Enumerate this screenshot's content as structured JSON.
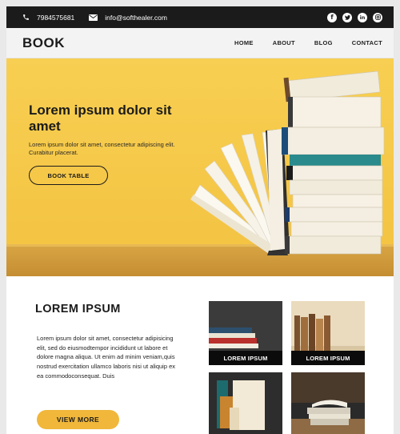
{
  "topbar": {
    "phone": "7984575681",
    "email": "info@softhealer.com",
    "social": [
      "facebook-icon",
      "twitter-icon",
      "linkedin-icon",
      "instagram-icon"
    ]
  },
  "nav": {
    "logo": "BOOK",
    "menu": [
      "HOME",
      "ABOUT",
      "BLOG",
      "CONTACT"
    ]
  },
  "hero": {
    "title": "Lorem ipsum dolor sit amet",
    "text": "Lorem ipsum dolor sit amet, consectetur adipiscing elit. Curabitur placerat.",
    "button": "BOOK TABLE"
  },
  "section": {
    "title": "LOREM IPSUM",
    "text": "Lorem ipsum dolor sit amet, consectetur adipisicing elit, sed do eiusmodtempor incididunt ut labore et dolore magna aliqua. Ut enim ad minim veniam,quis nostrud exercitation ullamco laboris nisi ut aliquip ex ea commodoconsequat. Duis",
    "button": "VIEW MORE",
    "tiles": [
      "LOREM IPSUM",
      "LOREM IPSUM"
    ]
  },
  "colors": {
    "topbar": "#1b1b1b",
    "hero_yellow": "#f6c94d",
    "accent_button": "#f0b73a"
  }
}
